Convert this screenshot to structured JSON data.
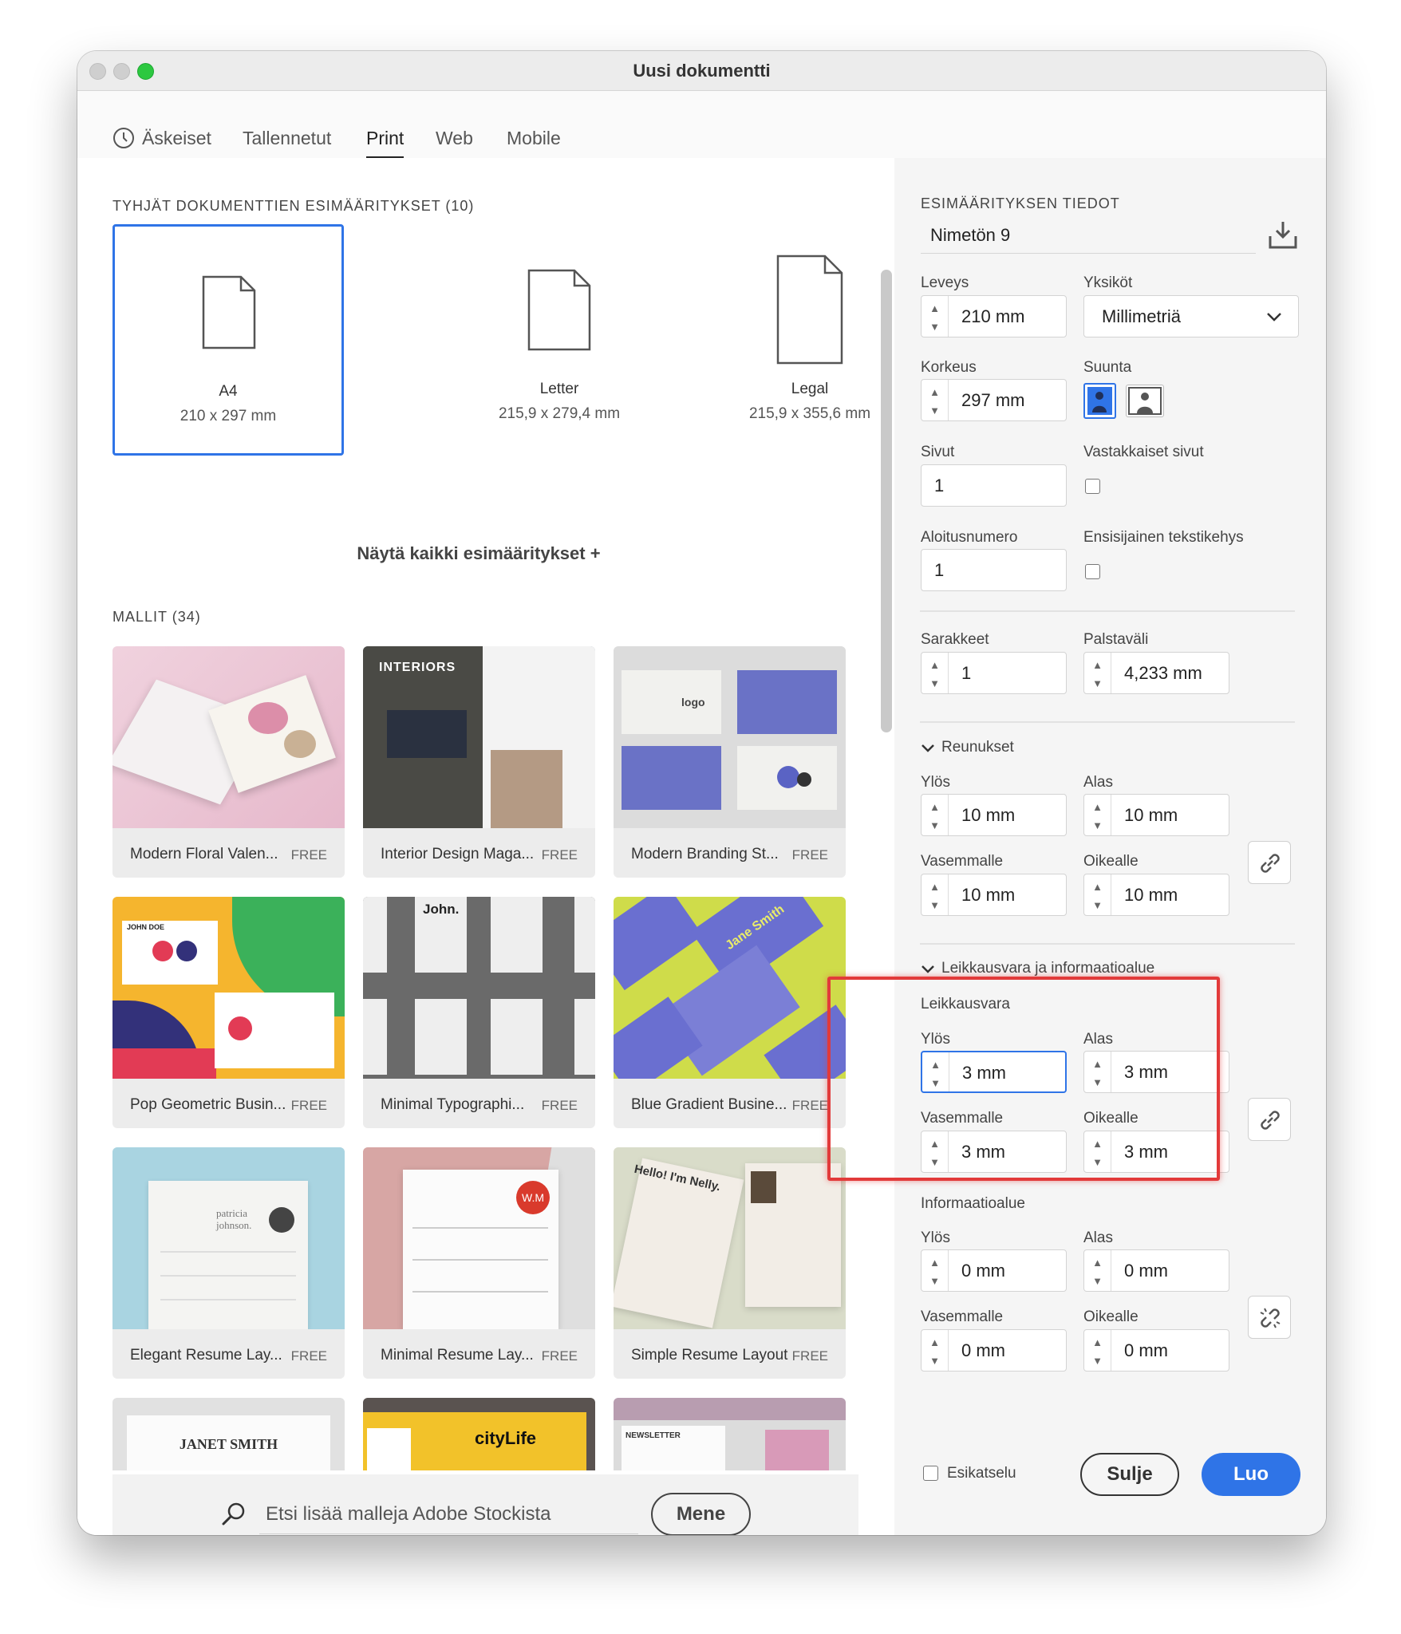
{
  "window": {
    "title": "Uusi dokumentti"
  },
  "tabs": [
    {
      "label": "Äskeiset",
      "icon": "clock-icon"
    },
    {
      "label": "Tallennetut"
    },
    {
      "label": "Print",
      "active": true
    },
    {
      "label": "Web"
    },
    {
      "label": "Mobile"
    }
  ],
  "left": {
    "presets_heading": "TYHJÄT DOKUMENTTIEN ESIMÄÄRITYKSET",
    "presets_count": "(10)",
    "presets": [
      {
        "name": "A4",
        "dims": "210 x 297 mm",
        "selected": true
      },
      {
        "name": "Letter",
        "dims": "215,9 x 279,4 mm"
      },
      {
        "name": "Legal",
        "dims": "215,9 x 355,6 mm"
      }
    ],
    "show_all": "Näytä kaikki esimääritykset",
    "templates_heading": "MALLIT",
    "templates_count": "(34)",
    "templates": [
      {
        "name": "Modern Floral Valen...",
        "badge": "FREE"
      },
      {
        "name": "Interior Design Maga...",
        "badge": "FREE",
        "thumb_text": "INTERIORS"
      },
      {
        "name": "Modern Branding St...",
        "badge": "FREE",
        "thumb_text": "logo"
      },
      {
        "name": "Pop Geometric Busin...",
        "badge": "FREE",
        "thumb_text": "JOHN DOE"
      },
      {
        "name": "Minimal Typographi...",
        "badge": "FREE",
        "thumb_text": "John."
      },
      {
        "name": "Blue Gradient Busine...",
        "badge": "FREE",
        "thumb_text": "Jane Smith"
      },
      {
        "name": "Elegant Resume Lay...",
        "badge": "FREE",
        "thumb_text": "patricia johnson."
      },
      {
        "name": "Minimal Resume Lay...",
        "badge": "FREE",
        "thumb_text": "W.M"
      },
      {
        "name": "Simple Resume Layout",
        "badge": "FREE",
        "thumb_text": "Hello! I'm Nelly."
      },
      {
        "name": "",
        "badge": "",
        "thumb_text": "JANET SMITH"
      },
      {
        "name": "",
        "badge": "",
        "thumb_text": "cityLife"
      },
      {
        "name": "",
        "badge": "",
        "thumb_text": "NEWSLETTER"
      }
    ],
    "search": {
      "placeholder": "Etsi lisää malleja Adobe Stockista",
      "button": "Mene"
    }
  },
  "right": {
    "heading": "ESIMÄÄRITYKSEN TIEDOT",
    "doc_name": "Nimetön 9",
    "width_label": "Leveys",
    "width": "210 mm",
    "units_label": "Yksiköt",
    "units": "Millimetriä",
    "height_label": "Korkeus",
    "height": "297 mm",
    "orientation_label": "Suunta",
    "pages_label": "Sivut",
    "pages": "1",
    "facing_label": "Vastakkaiset sivut",
    "start_label": "Aloitusnumero",
    "start": "1",
    "primary_label": "Ensisijainen tekstikehys",
    "columns_label": "Sarakkeet",
    "columns": "1",
    "gutter_label": "Palstaväli",
    "gutter": "4,233 mm",
    "margins": {
      "title": "Reunukset",
      "top_label": "Ylös",
      "top": "10 mm",
      "bottom_label": "Alas",
      "bottom": "10 mm",
      "left_label": "Vasemmalle",
      "left": "10 mm",
      "right_label": "Oikealle",
      "right": "10 mm"
    },
    "bleed_section": "Leikkausvara ja informaatioalue",
    "bleed": {
      "title": "Leikkausvara",
      "top_label": "Ylös",
      "top": "3 mm",
      "bottom_label": "Alas",
      "bottom": "3 mm",
      "left_label": "Vasemmalle",
      "left": "3 mm",
      "right_label": "Oikealle",
      "right": "3 mm"
    },
    "slug": {
      "title": "Informaatioalue",
      "top_label": "Ylös",
      "top": "0 mm",
      "bottom_label": "Alas",
      "bottom": "0 mm",
      "left_label": "Vasemmalle",
      "left": "0 mm",
      "right_label": "Oikealle",
      "right": "0 mm"
    },
    "preview_label": "Esikatselu",
    "close_button": "Sulje",
    "create_button": "Luo"
  },
  "colors": {
    "accent": "#2f74e7",
    "highlight": "#e23a3a",
    "create": "#2f74e7"
  }
}
